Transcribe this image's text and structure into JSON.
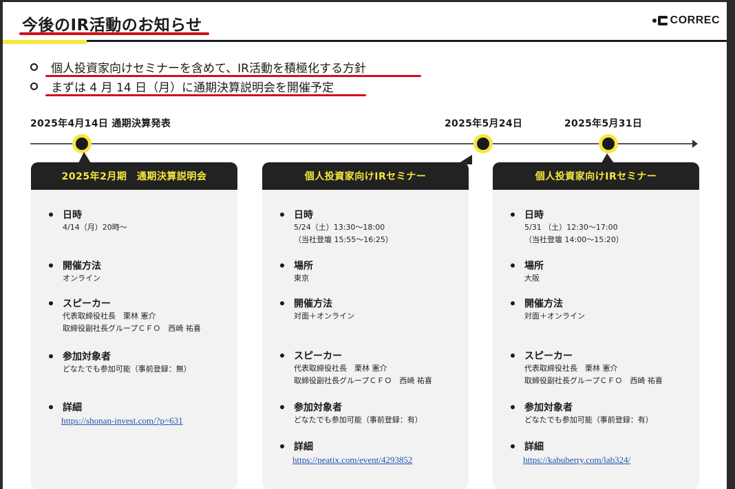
{
  "header": {
    "title": "今後のIR活動のお知らせ",
    "logo_text": "CORREC"
  },
  "bullets": [
    "個人投資家向けセミナーを含めて、IR活動を積極化する方針",
    "まずは 4 月 14 日（月）に通期決算説明会を開催予定"
  ],
  "timeline": {
    "labels": [
      "2025年4月14日 通期決算発表",
      "2025年5月24日",
      "2025年5月31日"
    ]
  },
  "cards": [
    {
      "title": "2025年2月期　通期決算説明会",
      "items": [
        {
          "label": "日時",
          "lines": [
            "4/14（月）20時～"
          ]
        },
        {
          "label": "開催方法",
          "lines": [
            "オンライン"
          ]
        },
        {
          "label": "スピーカー",
          "lines": [
            "代表取締役社長　栗林 憲介",
            "取締役副社長グループＣＦＯ　西崎 祐喜"
          ]
        },
        {
          "label": "参加対象者",
          "lines": [
            "どなたでも参加可能（事前登録：無）"
          ]
        },
        {
          "label": "詳細",
          "link": "https://shonan-invest.com/?p=631"
        }
      ]
    },
    {
      "title": "個人投資家向けIRセミナー",
      "items": [
        {
          "label": "日時",
          "lines": [
            "5/24（土）13:30～18:00",
            "（当社登壇 15:55～16:25）"
          ]
        },
        {
          "label": "場所",
          "lines": [
            "東京"
          ]
        },
        {
          "label": "開催方法",
          "lines": [
            "対面＋オンライン"
          ]
        },
        {
          "label": "スピーカー",
          "lines": [
            "代表取締役社長　栗林 憲介",
            "取締役副社長グループＣＦＯ　西崎 祐喜"
          ]
        },
        {
          "label": "参加対象者",
          "lines": [
            "どなたでも参加可能（事前登録：有）"
          ]
        },
        {
          "label": "詳細",
          "link": "https://peatix.com/event/4293852"
        }
      ]
    },
    {
      "title": "個人投資家向けIRセミナー",
      "items": [
        {
          "label": "日時",
          "lines": [
            "5/31 （土）12:30～17:00",
            "（当社登壇 14:00～15:20）"
          ]
        },
        {
          "label": "場所",
          "lines": [
            "大阪"
          ]
        },
        {
          "label": "開催方法",
          "lines": [
            "対面＋オンライン"
          ]
        },
        {
          "label": "スピーカー",
          "lines": [
            "代表取締役社長　栗林 憲介",
            "取締役副社長グループＣＦＯ　西崎 祐喜"
          ]
        },
        {
          "label": "参加対象者",
          "lines": [
            "どなたでも参加可能（事前登録：有）"
          ]
        },
        {
          "label": "詳細",
          "link": "https://kabuberry.com/lab324/"
        }
      ]
    }
  ],
  "colors": {
    "accent_yellow": "#f5e83c",
    "underline_red": "#d0101b",
    "card_header": "#222222",
    "card_bg": "#f2f2f2",
    "link": "#2453b3"
  }
}
